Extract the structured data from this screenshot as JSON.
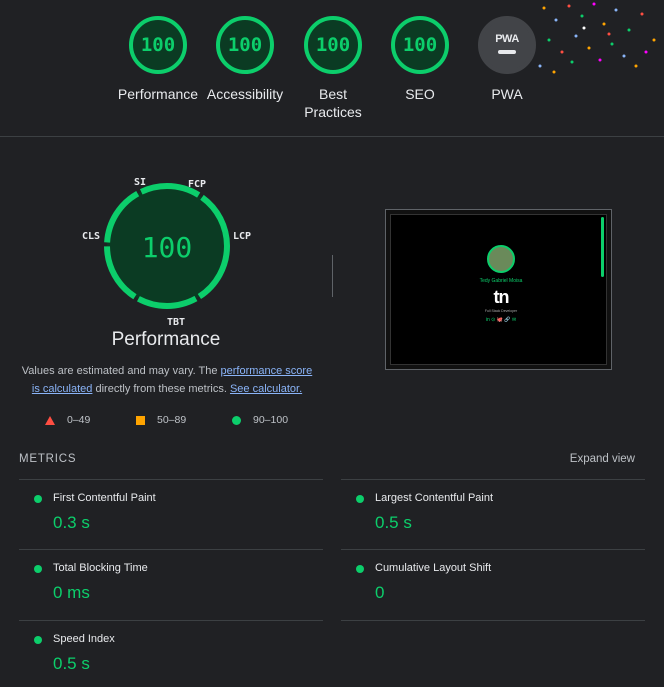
{
  "categories": [
    {
      "label": "Performance",
      "score": "100"
    },
    {
      "label": "Accessibility",
      "score": "100"
    },
    {
      "label": "Best Practices",
      "score": "100"
    },
    {
      "label": "SEO",
      "score": "100"
    },
    {
      "label": "PWA",
      "score": "PWA"
    }
  ],
  "perf": {
    "score": "100",
    "title": "Performance",
    "gauge_labels": {
      "si": "SI",
      "fcp": "FCP",
      "lcp": "LCP",
      "tbt": "TBT",
      "cls": "CLS"
    },
    "desc_pre": "Values are estimated and may vary. The ",
    "desc_link1": "performance score is calculated",
    "desc_mid": " directly from these metrics. ",
    "desc_link2": "See calculator."
  },
  "legend": {
    "bad": "0–49",
    "avg": "50–89",
    "good": "90–100"
  },
  "thumbnail": {
    "name": "Tedy Gabriel Moisa",
    "logo": "tn",
    "subtitle": "Full Stack Developer",
    "icons": "in ⊙ 🐙 🔗 ✉"
  },
  "metrics": {
    "heading": "METRICS",
    "expand": "Expand view",
    "items": [
      {
        "name": "First Contentful Paint",
        "value": "0.3 s"
      },
      {
        "name": "Largest Contentful Paint",
        "value": "0.5 s"
      },
      {
        "name": "Total Blocking Time",
        "value": "0 ms"
      },
      {
        "name": "Cumulative Layout Shift",
        "value": "0"
      },
      {
        "name": "Speed Index",
        "value": "0.5 s"
      }
    ]
  },
  "colors": {
    "good": "#0cce6b",
    "average": "#ffa400",
    "fail": "#ff4e42",
    "background": "#202124"
  }
}
